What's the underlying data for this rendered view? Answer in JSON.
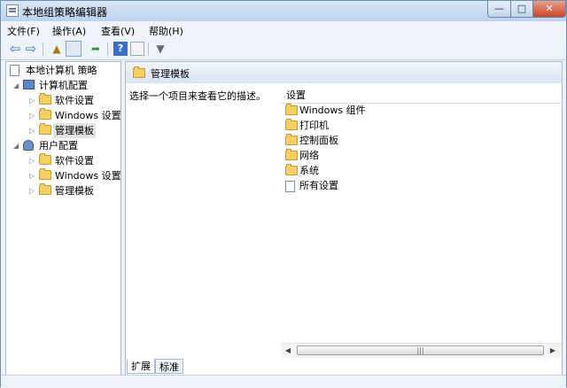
{
  "window": {
    "title": "本地组策略编辑器",
    "controls": {
      "minimize": "—",
      "maximize": "□",
      "close": "✕"
    }
  },
  "menu": [
    "文件(F)",
    "操作(A)",
    "查看(V)",
    "帮助(H)"
  ],
  "toolbar_icons": [
    "back-icon",
    "forward-icon",
    "up-folder-icon",
    "show-tree-icon",
    "export-list-icon",
    "help-icon",
    "properties-icon",
    "filter-icon"
  ],
  "tree": {
    "root": "本地计算机 策略",
    "computer": {
      "label": "计算机配置",
      "children": [
        "软件设置",
        "Windows 设置",
        "管理模板"
      ]
    },
    "user": {
      "label": "用户配置",
      "children": [
        "软件设置",
        "Windows 设置",
        "管理模板"
      ]
    }
  },
  "right": {
    "header_title": "管理模板",
    "description": "选择一个项目来查看它的描述。",
    "column_title": "设置",
    "items": [
      "Windows 组件",
      "打印机",
      "控制面板",
      "网络",
      "系统",
      "所有设置"
    ]
  },
  "tabs": [
    "扩展",
    "标准"
  ],
  "colors": {
    "accent": "#3b6fc7",
    "folder": "#f4cf65",
    "close": "#c9462b"
  }
}
